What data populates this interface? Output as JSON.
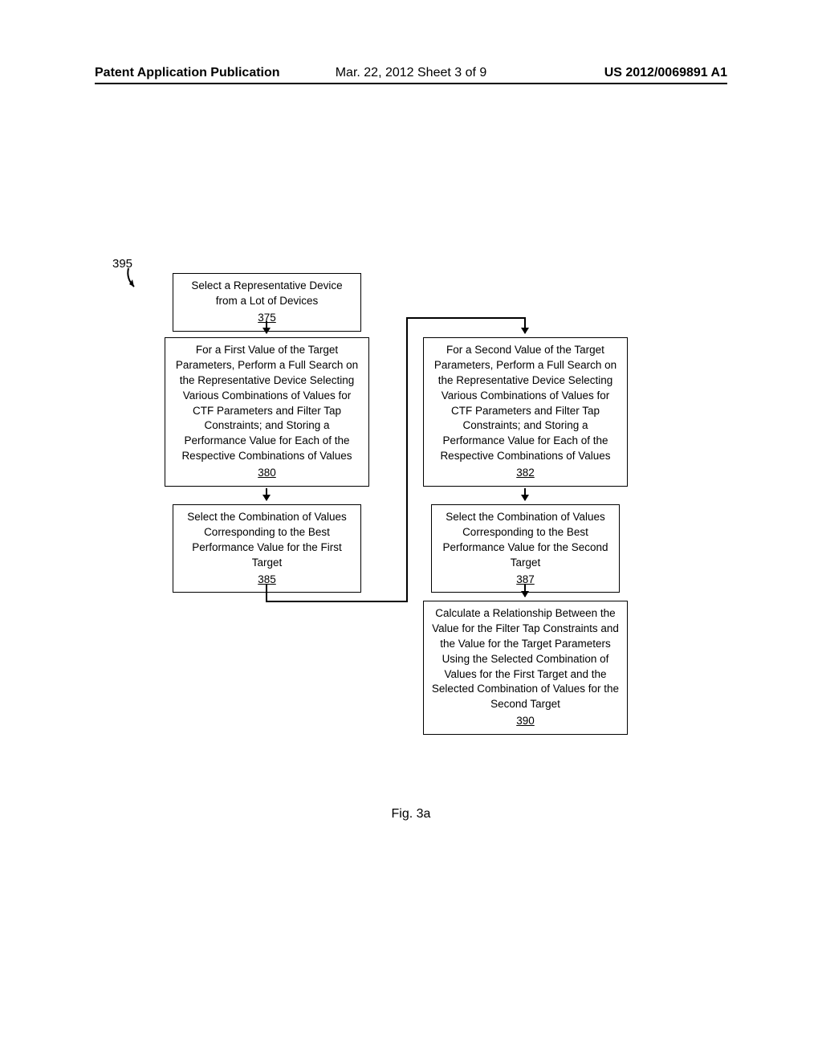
{
  "header": {
    "left": "Patent Application Publication",
    "center": "Mar. 22, 2012  Sheet 3 of 9",
    "right": "US 2012/0069891 A1"
  },
  "flow_ref": "395",
  "boxes": {
    "b375": {
      "text": "Select a Representative Device from a Lot of Devices",
      "num": "375"
    },
    "b380": {
      "text": "For a First Value of the Target Parameters, Perform a Full Search on the Representative Device Selecting Various Combinations of Values for CTF Parameters and Filter Tap Constraints; and Storing a Performance Value for Each of the Respective Combinations of Values",
      "num": "380"
    },
    "b385": {
      "text": "Select the Combination of Values Corresponding to the Best Performance Value for the First Target",
      "num": "385"
    },
    "b382": {
      "text": "For a Second Value of the Target Parameters, Perform a Full Search on the Representative Device Selecting Various Combinations of Values for CTF Parameters and Filter Tap Constraints; and Storing a Performance Value for Each of the Respective Combinations of Values",
      "num": "382"
    },
    "b387": {
      "text": "Select the Combination of Values Corresponding to the Best Performance Value for the Second Target",
      "num": "387"
    },
    "b390": {
      "text": "Calculate a Relationship Between the Value for the Filter Tap Constraints and the Value for the Target Parameters Using the Selected Combination of Values for the First Target and the Selected Combination of Values for the Second Target",
      "num": "390"
    }
  },
  "figure_label": "Fig. 3a"
}
